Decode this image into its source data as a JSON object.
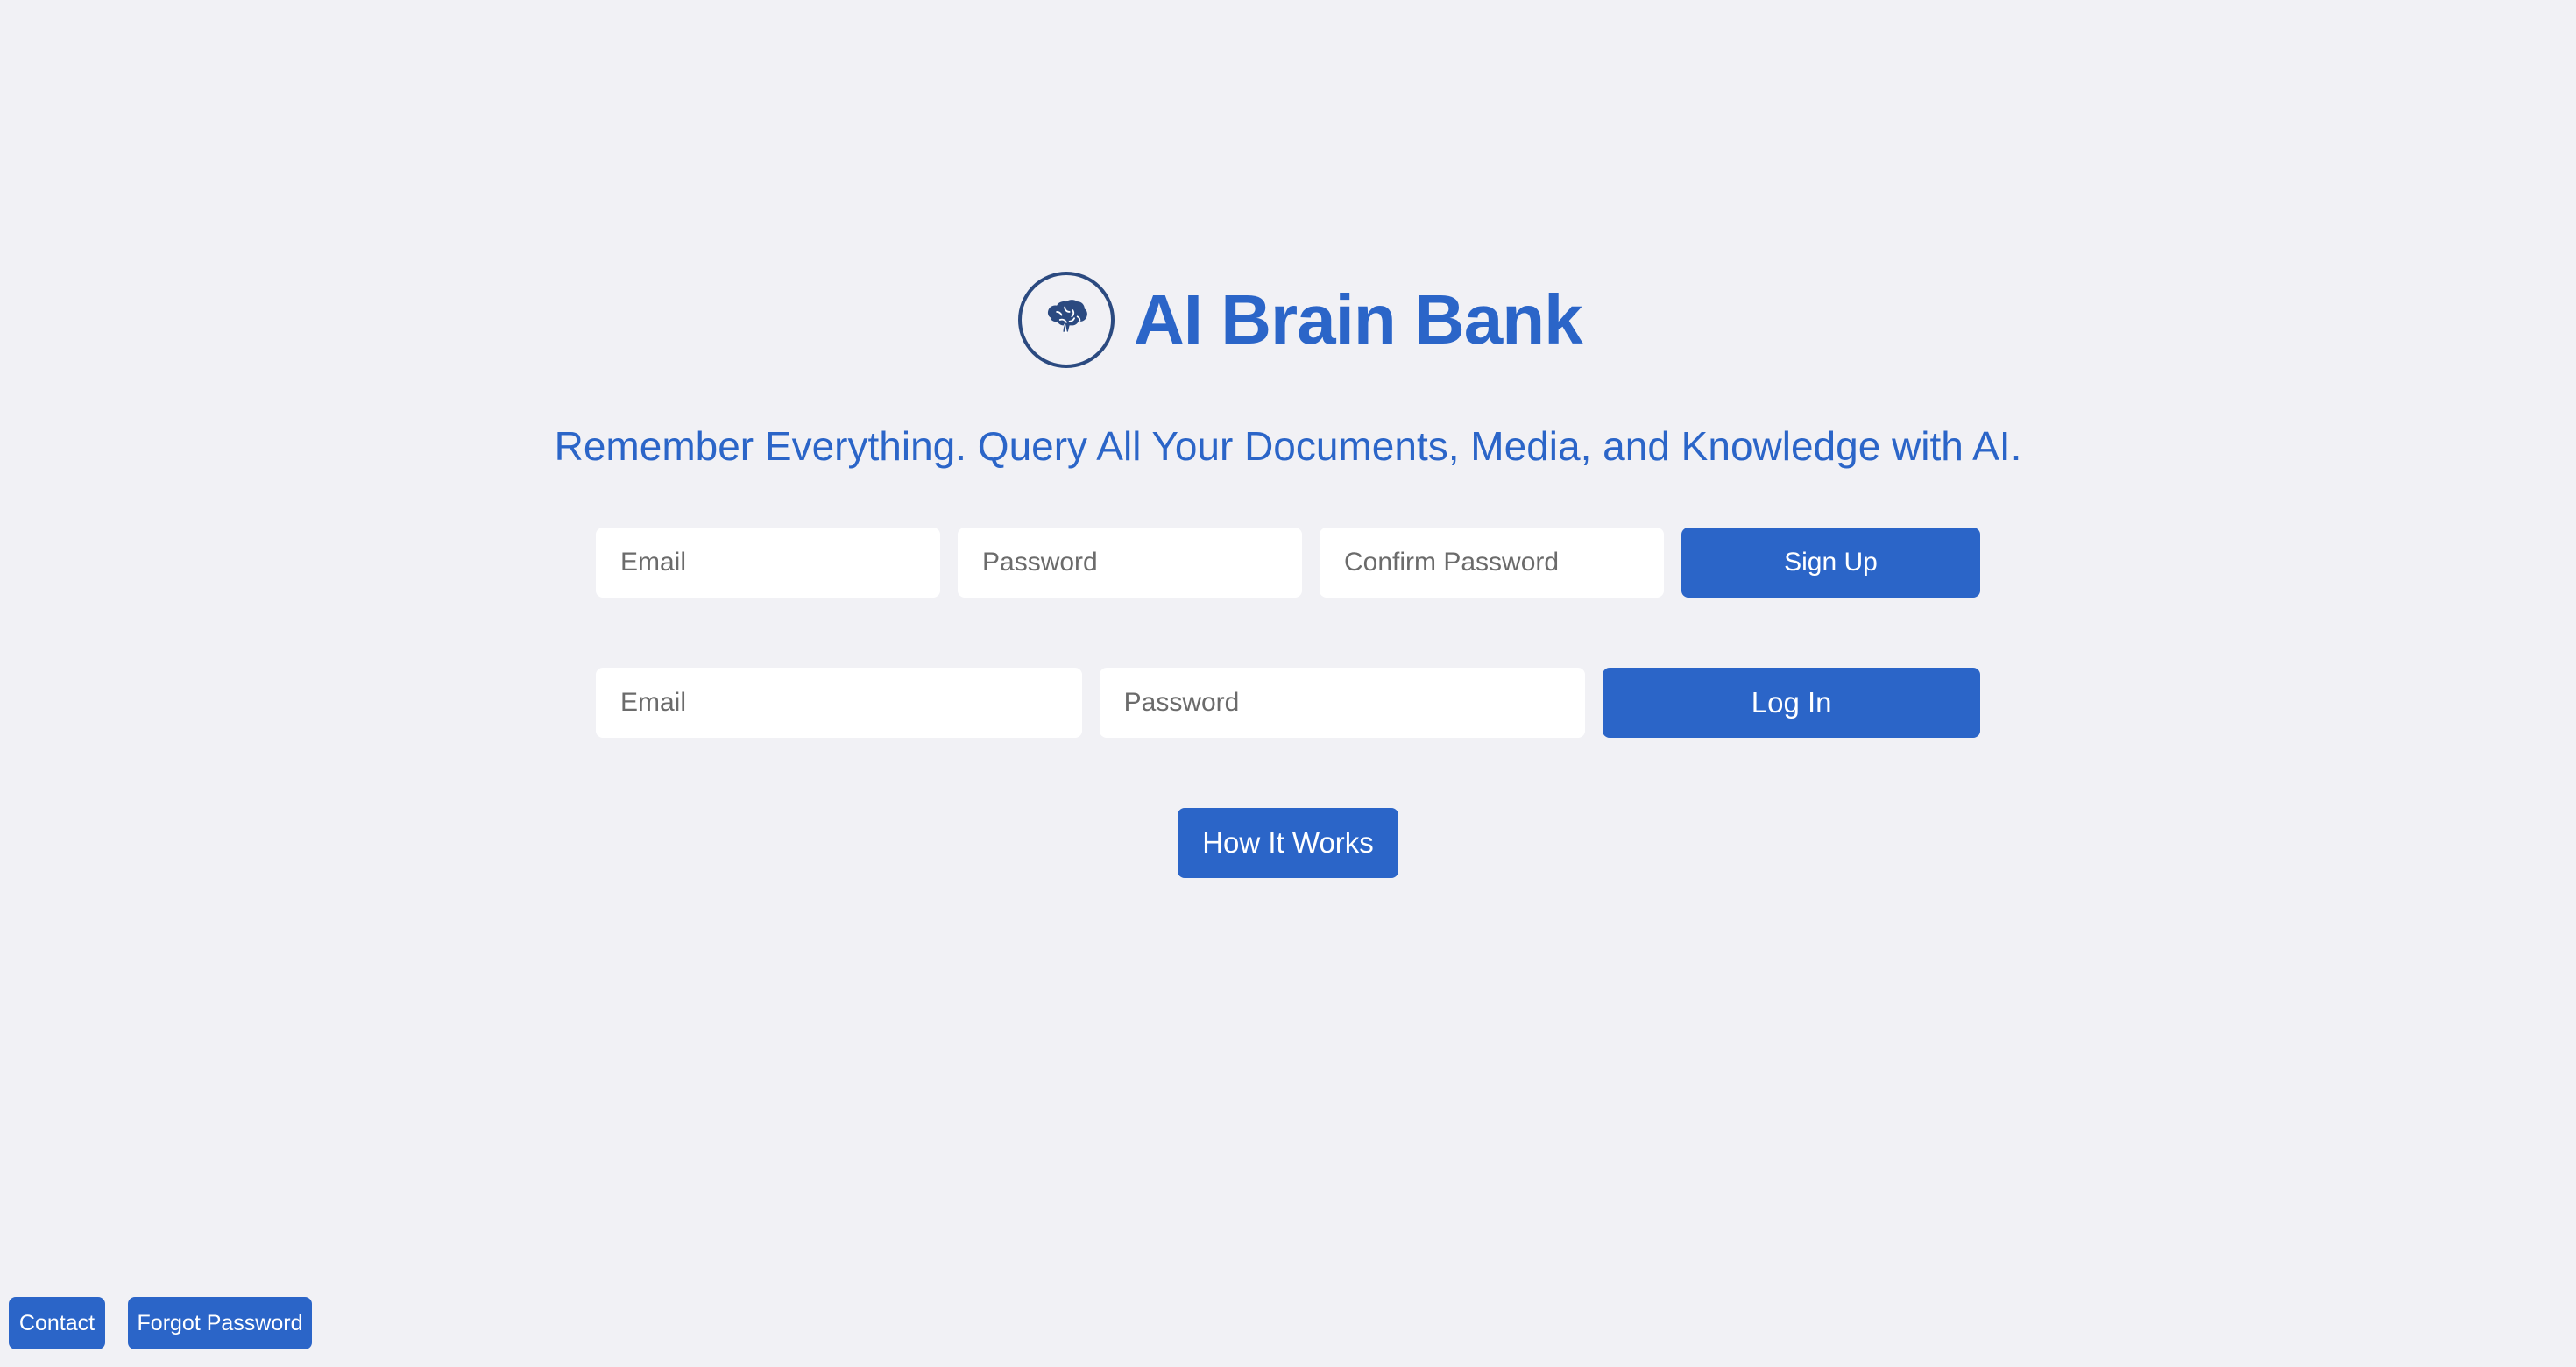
{
  "brand": {
    "title": "AI Brain Bank",
    "logo_icon": "brain-icon",
    "colors": {
      "accent": "#2b65c8",
      "logo_ring": "#2b4a80",
      "background": "#f1f1f5"
    }
  },
  "tagline": "Remember Everything. Query All Your Documents, Media, and Knowledge with AI.",
  "signup": {
    "email_placeholder": "Email",
    "password_placeholder": "Password",
    "confirm_placeholder": "Confirm Password",
    "button_label": "Sign Up"
  },
  "login": {
    "email_placeholder": "Email",
    "password_placeholder": "Password",
    "button_label": "Log In"
  },
  "how_it_works_label": "How It Works",
  "footer": {
    "contact_label": "Contact",
    "forgot_label": "Forgot Password"
  }
}
